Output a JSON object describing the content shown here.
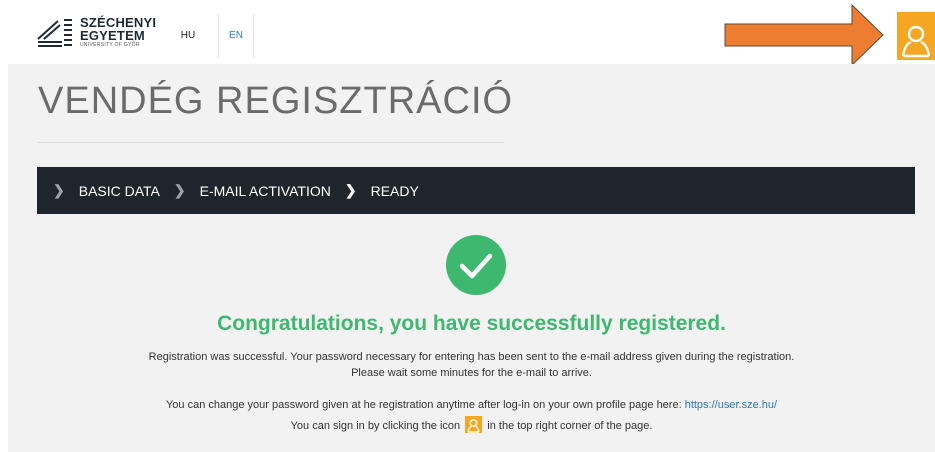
{
  "header": {
    "logo": {
      "line1": "SZÉCHENYI",
      "line2": "EGYETEM",
      "line3": "UNIVERSITY OF GYŐR"
    },
    "languages": [
      {
        "label": "HU",
        "active": false
      },
      {
        "label": "EN",
        "active": true
      }
    ],
    "user_button_icon": "user-icon",
    "accent_color": "#f5a623"
  },
  "annotation": {
    "arrow_color": "#ec7d31"
  },
  "main": {
    "title": "VENDÉG REGISZTRÁCIÓ",
    "steps": [
      {
        "label": "BASIC DATA"
      },
      {
        "label": "E-MAIL ACTIVATION"
      },
      {
        "label": "READY"
      }
    ],
    "success_icon": "check-circle-icon",
    "success_color": "#3fb86f",
    "congrats": "Congratulations, you have successfully registered.",
    "message_line1": "Registration was successful. Your password necessary for entering has been sent to the e-mail address given during the registration.",
    "message_line2": "Please wait some minutes for the e-mail to arrive.",
    "message_line3_prefix": "You can change your password given at he registration anytime after log-in on your own profile page here: ",
    "message_line3_link": "https://user.sze.hu/",
    "message_line4_prefix": "You can sign in by clicking the icon ",
    "message_line4_suffix": " in the top right corner of the page."
  }
}
